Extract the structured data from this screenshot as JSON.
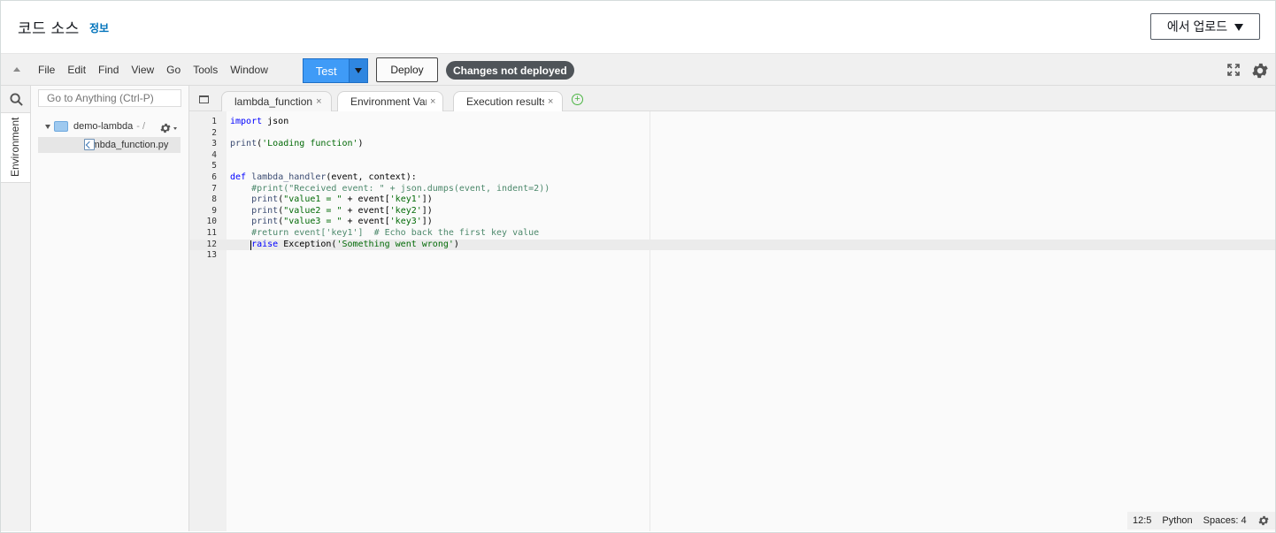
{
  "header": {
    "title": "코드 소스",
    "info_link": "정보",
    "upload_button": "에서 업로드"
  },
  "toolbar": {
    "menu": [
      "File",
      "Edit",
      "Find",
      "View",
      "Go",
      "Tools",
      "Window"
    ],
    "test_label": "Test",
    "deploy_label": "Deploy",
    "status_badge": "Changes not deployed"
  },
  "rail": {
    "environment_tab": "Environment"
  },
  "tree": {
    "search_placeholder": "Go to Anything (Ctrl-P)",
    "root_folder": "demo-lambda",
    "root_suffix": "- /",
    "file": "lambda_function.py"
  },
  "tabs": [
    {
      "label": "lambda_function",
      "close": "×",
      "active": true
    },
    {
      "label": "Environment Vari",
      "close": "×",
      "active": false
    },
    {
      "label": "Execution results",
      "close": "×",
      "active": false
    }
  ],
  "editor": {
    "lines": [
      {
        "n": "1",
        "html": "<span class=\"kw\">import</span> json"
      },
      {
        "n": "2",
        "html": ""
      },
      {
        "n": "3",
        "html": "<span class=\"fn\">print</span>(<span class=\"st\">'Loading function'</span>)"
      },
      {
        "n": "4",
        "html": ""
      },
      {
        "n": "5",
        "html": ""
      },
      {
        "n": "6",
        "html": "<span class=\"kw\">def</span> <span class=\"fn\">lambda_handler</span>(event, context):"
      },
      {
        "n": "7",
        "html": "    <span class=\"cm\">#print(\"Received event: \" + json.dumps(event, indent=2))</span>"
      },
      {
        "n": "8",
        "html": "    <span class=\"fn\">print</span>(<span class=\"st\">\"value1 = \"</span> + event[<span class=\"st\">'key1'</span>])"
      },
      {
        "n": "9",
        "html": "    <span class=\"fn\">print</span>(<span class=\"st\">\"value2 = \"</span> + event[<span class=\"st\">'key2'</span>])"
      },
      {
        "n": "10",
        "html": "    <span class=\"fn\">print</span>(<span class=\"st\">\"value3 = \"</span> + event[<span class=\"st\">'key3'</span>])"
      },
      {
        "n": "11",
        "html": "    <span class=\"cm\">#return event['key1']  # Echo back the first key value</span>"
      },
      {
        "n": "12",
        "html": "    <span class=\"kw\">raise</span> Exception(<span class=\"st\">'Something went wrong'</span>)",
        "current": true
      },
      {
        "n": "13",
        "html": ""
      }
    ]
  },
  "statusbar": {
    "position": "12:5",
    "language": "Python",
    "spaces": "Spaces: 4"
  },
  "colors": {
    "accent": "#3f9bf7",
    "link": "#0073bb",
    "badge": "#4f5459"
  }
}
